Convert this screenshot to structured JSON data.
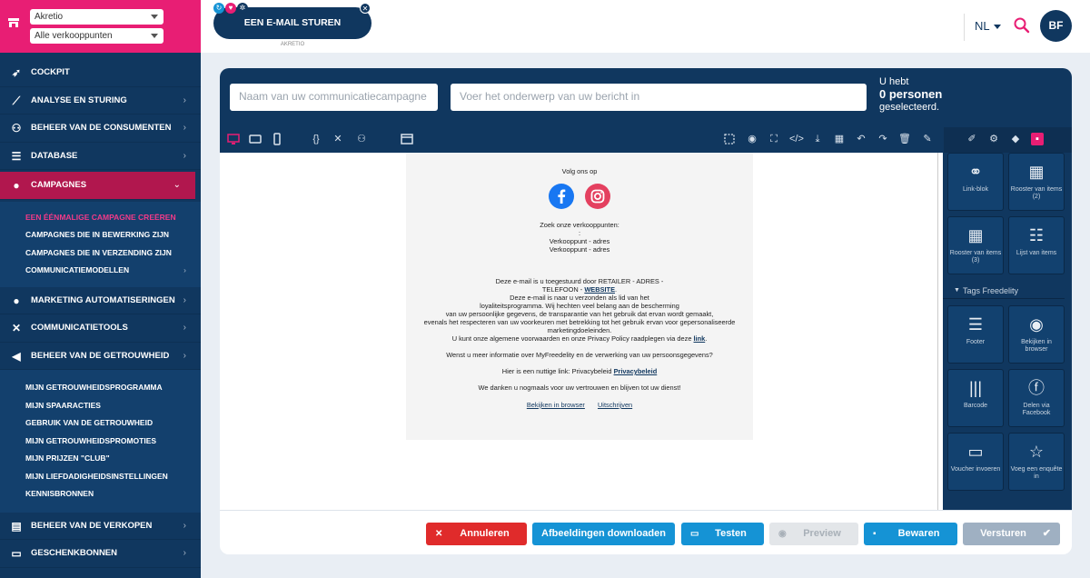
{
  "sidebar": {
    "store_select": "Akretio",
    "pos_select": "Alle verkooppunten",
    "nav": [
      {
        "label": "COCKPIT",
        "icon": "rocket-icon"
      },
      {
        "label": "ANALYSE EN STURING",
        "icon": "chart-line-icon"
      },
      {
        "label": "BEHEER VAN DE CONSUMENTEN",
        "icon": "users-icon"
      },
      {
        "label": "DATABASE",
        "icon": "database-icon"
      },
      {
        "label": "CAMPAGNES",
        "icon": "comment-icon"
      }
    ],
    "campagnes_sub": [
      "EEN ÉÉNMALIGE CAMPAGNE CREËREN",
      "CAMPAGNES DIE IN BEWERKING ZIJN",
      "CAMPAGNES DIE IN VERZENDING ZIJN",
      "COMMUNICATIEMODELLEN"
    ],
    "nav2": [
      {
        "label": "MARKETING AUTOMATISERINGEN",
        "icon": "comments-icon"
      },
      {
        "label": "COMMUNICATIETOOLS",
        "icon": "tools-icon"
      },
      {
        "label": "BEHEER VAN DE GETROUWHEID",
        "icon": "megaphone-icon"
      }
    ],
    "loyalty_sub": [
      "MIJN GETROUWHEIDSPROGRAMMA",
      "MIJN SPAARACTIES",
      "GEBRUIK VAN DE GETROUWHEID",
      "MIJN GETROUWHEIDSPROMOTIES",
      "MIJN PRIJZEN \"CLUB\"",
      "MIJN LIEFDADIGHEIDSINSTELLINGEN",
      "KENNISBRONNEN"
    ],
    "nav3": [
      {
        "label": "BEHEER VAN DE VERKOPEN",
        "icon": "cash-register-icon"
      },
      {
        "label": "GESCHENKBONNEN",
        "icon": "gift-card-icon"
      }
    ]
  },
  "topbar": {
    "email_button": "EEN E-MAIL STUREN",
    "email_caption": "AKRETIO",
    "lang": "NL",
    "avatar": "BF"
  },
  "editor": {
    "name_placeholder": "Naam van uw communicatiecampagne",
    "subject_placeholder": "Voer het onderwerp van uw bericht in",
    "count_line1": "U hebt",
    "count_line2": "0 personen",
    "count_line3": "geselecteerd."
  },
  "email": {
    "follow": "Volg ons op",
    "find_stores": "Zoek onze verkooppunten:",
    "colon": ":",
    "store1": "Verkooppunt - adres",
    "store2": "Verkooppunt - adres",
    "legal1": "Deze e-mail is u toegestuurd door RETAILER - ADRES -",
    "legal2_pre": "TELEFOON - ",
    "legal2_link": "WEBSITE",
    "legal2_post": ".",
    "legal3": "Deze e-mail is naar u verzonden als lid van het",
    "legal4": "loyaliteitsprogramma. Wij hechten veel belang aan de bescherming",
    "legal5": "van uw persoonlijke gegevens, de transparantie van het gebruik dat ervan wordt gemaakt,",
    "legal6": "evenals het respecteren van uw voorkeuren met betrekking tot het gebruik ervan voor gepersonaliseerde",
    "legal7": "marketingdoeleinden.",
    "legal8_pre": "U kunt onze algemene voorwaarden en onze Privacy Policy raadplegen via deze ",
    "legal8_link": "link",
    "legal8_post": ".",
    "more_info": "Wenst u meer informatie over MyFreedelity en de verwerking van uw persoonsgegevens?",
    "useful_pre": "Hier is een nuttige link: Privacybeleid ",
    "useful_link": "Privacybeleid",
    "thanks": "We danken u nogmaals voor uw vertrouwen en blijven tot uw dienst!",
    "view_browser": "Bekijken in browser",
    "unsubscribe": "Uitschrijven"
  },
  "panel": {
    "blocks_top": [
      {
        "label": "Link-blok",
        "icon": "link-icon"
      },
      {
        "label": "Rooster van items (2)",
        "icon": "grid-icon"
      },
      {
        "label": "Rooster van items (3)",
        "icon": "grid-icon"
      },
      {
        "label": "Lijst van items",
        "icon": "list-icon"
      }
    ],
    "tags_header": "Tags Freedelity",
    "blocks_tags": [
      {
        "label": "Footer",
        "icon": "footer-icon"
      },
      {
        "label": "Bekijken in browser",
        "icon": "eye-icon"
      },
      {
        "label": "Barcode",
        "icon": "barcode-icon"
      },
      {
        "label": "Delen via Facebook",
        "icon": "facebook-icon"
      },
      {
        "label": "Voucher invoeren",
        "icon": "ticket-icon"
      },
      {
        "label": "Voeg een enquête in",
        "icon": "star-icon"
      }
    ]
  },
  "footer": {
    "cancel": "Annuleren",
    "download": "Afbeeldingen downloaden",
    "test": "Testen",
    "preview": "Preview",
    "save": "Bewaren",
    "send": "Versturen"
  },
  "colors": {
    "brand_pink": "#e81e74",
    "navy": "#10375f",
    "red": "#e02b2b",
    "blue": "#1593d5",
    "grey": "#e3e6e9",
    "slate": "#9fb0c2"
  }
}
